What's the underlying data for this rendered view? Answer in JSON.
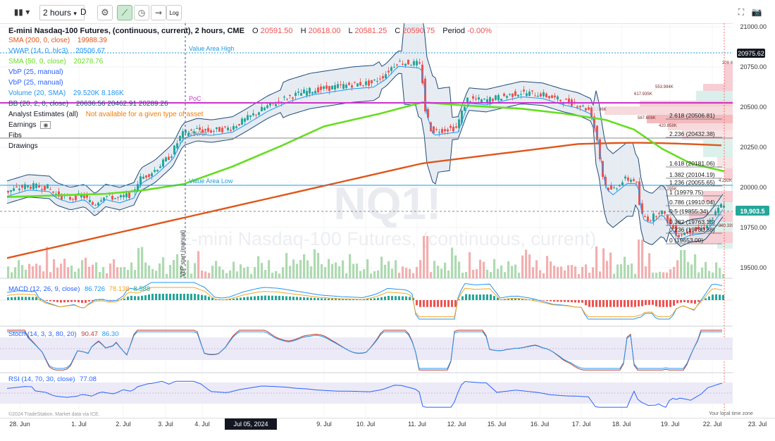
{
  "toolbar": {
    "interval": "2 hours",
    "interval_short": "D",
    "log_label": "Log"
  },
  "header": {
    "title": "E-mini Nasdaq-100 Futures, (continuous, current), 2 hours, CME",
    "open_label": "O",
    "open": "20591.50",
    "high_label": "H",
    "high": "20618.00",
    "low_label": "L",
    "low": "20581.25",
    "close_label": "C",
    "close": "20590.75",
    "period_label": "Period",
    "period": "-0.00%"
  },
  "legend": [
    {
      "name": "SMA (200, 0, close)",
      "value": "19988.39",
      "color": "#e0561a"
    },
    {
      "name": "VWAP (14, 0, hlc3)",
      "value": "20506.67",
      "color": "#2196f3"
    },
    {
      "name": "SMA (50, 0, close)",
      "value": "20278.76",
      "color": "#66dd22"
    },
    {
      "name": "VbP (25, manual)",
      "value": "",
      "color": "#2962ff"
    },
    {
      "name": "VbP (25, manual)",
      "value": "",
      "color": "#2962ff"
    },
    {
      "name": "Volume (20, SMA)",
      "value": "29.520K  8.186K",
      "color": "#2196f3"
    },
    {
      "name": "BB (20, 2, 0, close)",
      "value": "20636.56  20462.91  20289.26",
      "color": "#1e4a7a"
    },
    {
      "name": "Analyst Estimates (all)",
      "value": "Not available for a given type of asset",
      "color": "#f57c00"
    },
    {
      "name": "Earnings",
      "value": "",
      "color": "#131722"
    },
    {
      "name": "Fibs",
      "value": "",
      "color": "#131722"
    },
    {
      "name": "Drawings",
      "value": "",
      "color": "#131722"
    }
  ],
  "watermark": {
    "symbol": "NQ1!",
    "desc": "E-mini Nasdaq-100 Futures, (continuous, current)"
  },
  "annotations": {
    "value_area_high": "Value Area High",
    "value_area_low": "Value Area Low",
    "poc": "PoC",
    "vwap": "VWAP",
    "vbp_start": "VbP start (manual)"
  },
  "fib_levels": [
    "2.618 (20506.81)",
    "2.236 (20432.38)",
    "1.618 (20181.06)",
    "1.382 (20104.19)",
    "1.236 (20055.65)",
    "1 (19979.75)",
    "0.786 (19910.04)",
    "0.5 (19855.34)",
    "0.382 (19763.13)",
    "0.236 (19730.88)",
    "0 (19653.00)"
  ],
  "vbp_labels": [
    "209.877K",
    "214.109K",
    "553.994K",
    "617.935K",
    "832.186K",
    "587.608K",
    "420.858K",
    "400.295K",
    "364.834K",
    "360.339K",
    "4.292K"
  ],
  "price_axis": {
    "ticks": [
      "21000.00",
      "20750.00",
      "20500.00",
      "20250.00",
      "20000.00",
      "19750.00",
      "19500.00"
    ],
    "current_tag": "20975.62",
    "last_tag": "19,903.5"
  },
  "macd": {
    "label": "MACD (12, 26, 9, close)",
    "v1": "86.726",
    "v2": "78.138",
    "v3": "8.588",
    "ticks": [
      "100.000",
      "0.000",
      "-100.000"
    ]
  },
  "stoch": {
    "label": "Stoch (14, 3, 3, 80, 20)",
    "v1": "90.47",
    "v2": "86.30",
    "ticks": [
      "100.00",
      "50.00",
      "0.00"
    ]
  },
  "rsi": {
    "label": "RSI (14, 70, 30, close)",
    "v1": "77.08",
    "ticks": [
      "75.00",
      "50.00",
      "25.00"
    ]
  },
  "footer": {
    "copyright": "©2024 TradeStation. Market data via ICE.",
    "tz": "Your local time zone"
  },
  "xaxis": {
    "labels": [
      "28. Jun",
      "1. Jul",
      "2. Jul",
      "3. Jul",
      "4. Jul",
      "9. Jul",
      "10. Jul",
      "11. Jul",
      "12. Jul",
      "15. Jul",
      "16. Jul",
      "17. Jul",
      "18. Jul",
      "19. Jul",
      "22. Jul",
      "23. Jul"
    ],
    "highlight": "Jul 05, 2024 08:00"
  },
  "colors": {
    "up": "#26a69a",
    "down": "#ef5350",
    "sma200": "#e0561a",
    "sma50": "#66dd22",
    "bb": "#1e4a7a",
    "poc": "#cc33cc",
    "va": "#1e9be0"
  }
}
